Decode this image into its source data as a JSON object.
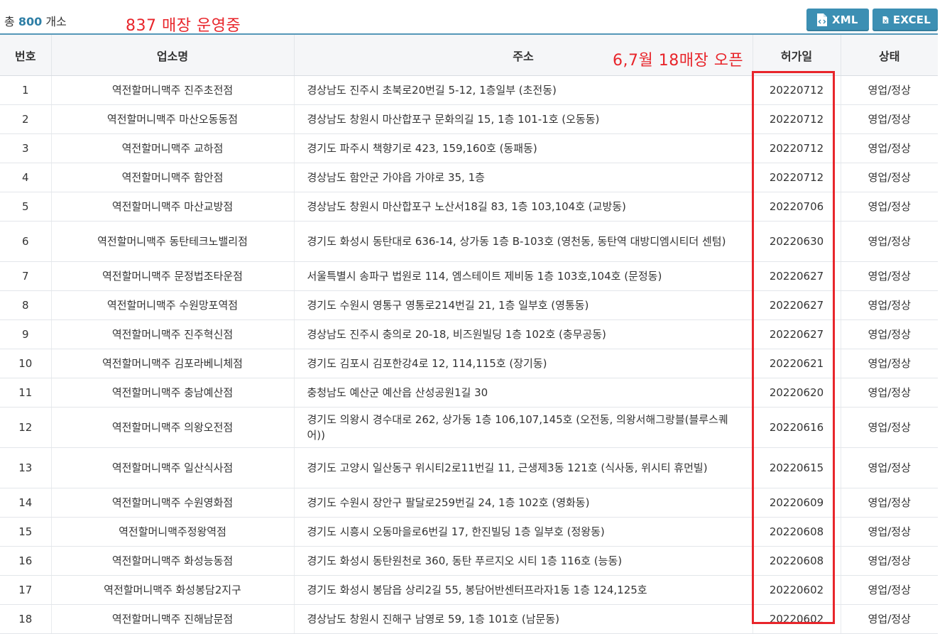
{
  "summary": {
    "prefix": "총",
    "count": "800",
    "suffix": "개소"
  },
  "annotations": {
    "stores_operating": "837 매장 운영중",
    "opened": "6,7월 18매장 오픈"
  },
  "buttons": {
    "xml": "XML",
    "excel": "EXCEL"
  },
  "colors": {
    "accent": "#3c8fb3",
    "annotation": "#e8252b",
    "header_bg": "#f5f6f8"
  },
  "table": {
    "headers": {
      "no": "번호",
      "name": "업소명",
      "address": "주소",
      "date": "허가일",
      "status": "상태"
    },
    "rows": [
      {
        "no": "1",
        "name": "역전할머니맥주 진주초전점",
        "address": "경상남도 진주시 초북로20번길 5-12, 1층일부 (초전동)",
        "date": "20220712",
        "status": "영업/정상"
      },
      {
        "no": "2",
        "name": "역전할머니맥주 마산오동동점",
        "address": "경상남도 창원시 마산합포구 문화의길 15, 1층 101-1호 (오동동)",
        "date": "20220712",
        "status": "영업/정상"
      },
      {
        "no": "3",
        "name": "역전할머니맥주 교하점",
        "address": "경기도 파주시 책향기로 423, 159,160호 (동패동)",
        "date": "20220712",
        "status": "영업/정상"
      },
      {
        "no": "4",
        "name": "역전할머니맥주 함안점",
        "address": "경상남도 함안군 가야읍 가야로 35, 1층",
        "date": "20220712",
        "status": "영업/정상"
      },
      {
        "no": "5",
        "name": "역전할머니맥주 마산교방점",
        "address": "경상남도 창원시 마산합포구 노산서18길 83, 1층 103,104호 (교방동)",
        "date": "20220706",
        "status": "영업/정상"
      },
      {
        "no": "6",
        "name": "역전할머니맥주 동탄테크노밸리점",
        "address": "경기도 화성시 동탄대로 636-14, 상가동 1층 B-103호 (영천동, 동탄역 대방디엠시티더 센텀)",
        "date": "20220630",
        "status": "영업/정상"
      },
      {
        "no": "7",
        "name": "역전할머니맥주 문정법조타운점",
        "address": "서울특별시 송파구 법원로 114, 엠스테이트 제비동 1층 103호,104호 (문정동)",
        "date": "20220627",
        "status": "영업/정상"
      },
      {
        "no": "8",
        "name": "역전할머니맥주 수원망포역점",
        "address": "경기도 수원시 영통구 영통로214번길 21, 1층 일부호 (영통동)",
        "date": "20220627",
        "status": "영업/정상"
      },
      {
        "no": "9",
        "name": "역전할머니맥주 진주혁신점",
        "address": "경상남도 진주시 충의로 20-18, 비즈원빌딩 1층 102호 (충무공동)",
        "date": "20220627",
        "status": "영업/정상"
      },
      {
        "no": "10",
        "name": "역전할머니맥주 김포라베니체점",
        "address": "경기도 김포시 김포한강4로 12, 114,115호 (장기동)",
        "date": "20220621",
        "status": "영업/정상"
      },
      {
        "no": "11",
        "name": "역전할머니맥주 충남예산점",
        "address": "충청남도 예산군 예산읍 산성공원1길 30",
        "date": "20220620",
        "status": "영업/정상"
      },
      {
        "no": "12",
        "name": "역전할머니맥주 의왕오전점",
        "address": "경기도 의왕시 경수대로 262, 상가동 1층 106,107,145호 (오전동, 의왕서해그랑블(블루스퀘어))",
        "date": "20220616",
        "status": "영업/정상"
      },
      {
        "no": "13",
        "name": "역전할머니맥주 일산식사점",
        "address": "경기도 고양시 일산동구 위시티2로11번길 11, 근생제3동 121호 (식사동, 위시티 휴먼빌)",
        "date": "20220615",
        "status": "영업/정상"
      },
      {
        "no": "14",
        "name": "역전할머니맥주 수원영화점",
        "address": "경기도 수원시 장안구 팔달로259번길 24, 1층 102호 (영화동)",
        "date": "20220609",
        "status": "영업/정상"
      },
      {
        "no": "15",
        "name": "역전할머니맥주정왕역점",
        "address": "경기도 시흥시 오동마을로6번길 17, 한진빌딩 1층 일부호 (정왕동)",
        "date": "20220608",
        "status": "영업/정상"
      },
      {
        "no": "16",
        "name": "역전할머니맥주 화성능동점",
        "address": "경기도 화성시 동탄원천로 360, 동탄 푸르지오 시티 1층 116호 (능동)",
        "date": "20220608",
        "status": "영업/정상"
      },
      {
        "no": "17",
        "name": "역전할머니맥주 화성봉담2지구",
        "address": "경기도 화성시 봉담읍 상리2길 55, 봉담어반센터프라자1동 1층 124,125호",
        "date": "20220602",
        "status": "영업/정상"
      },
      {
        "no": "18",
        "name": "역전할머니맥주 진해남문점",
        "address": "경상남도 창원시 진해구 남영로 59, 1층 101호 (남문동)",
        "date": "20220602",
        "status": "영업/정상"
      }
    ]
  }
}
